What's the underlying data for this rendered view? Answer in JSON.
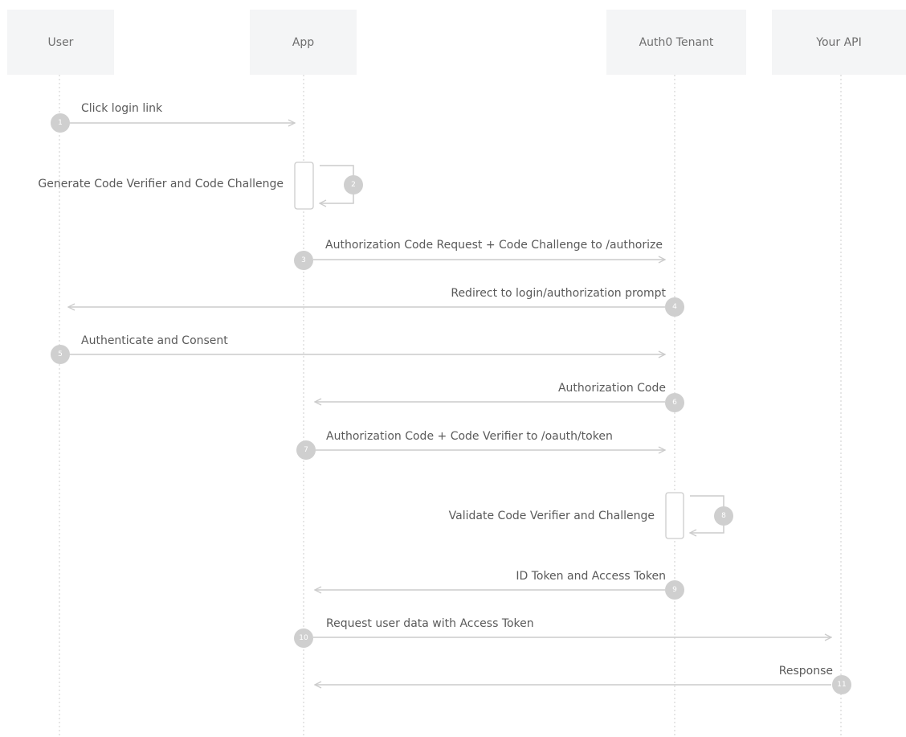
{
  "participants": [
    "User",
    "App",
    "Auth0 Tenant",
    "Your API"
  ],
  "steps": [
    {
      "n": "1",
      "label": "Click login link"
    },
    {
      "n": "2",
      "label": "Generate Code Verifier and Code Challenge"
    },
    {
      "n": "3",
      "label": "Authorization Code Request + Code Challenge to /authorize"
    },
    {
      "n": "4",
      "label": "Redirect to login/authorization prompt"
    },
    {
      "n": "5",
      "label": "Authenticate and Consent"
    },
    {
      "n": "6",
      "label": "Authorization Code"
    },
    {
      "n": "7",
      "label": "Authorization Code + Code Verifier to /oauth/token"
    },
    {
      "n": "8",
      "label": "Validate Code Verifier and Challenge"
    },
    {
      "n": "9",
      "label": "ID Token and Access Token"
    },
    {
      "n": "10",
      "label": "Request user data with Access Token"
    },
    {
      "n": "11",
      "label": "Response"
    }
  ],
  "colors": {
    "line": "#cccccc",
    "badge": "#cfcfcf",
    "box": "#f4f5f6",
    "text": "#5a5a5a"
  }
}
